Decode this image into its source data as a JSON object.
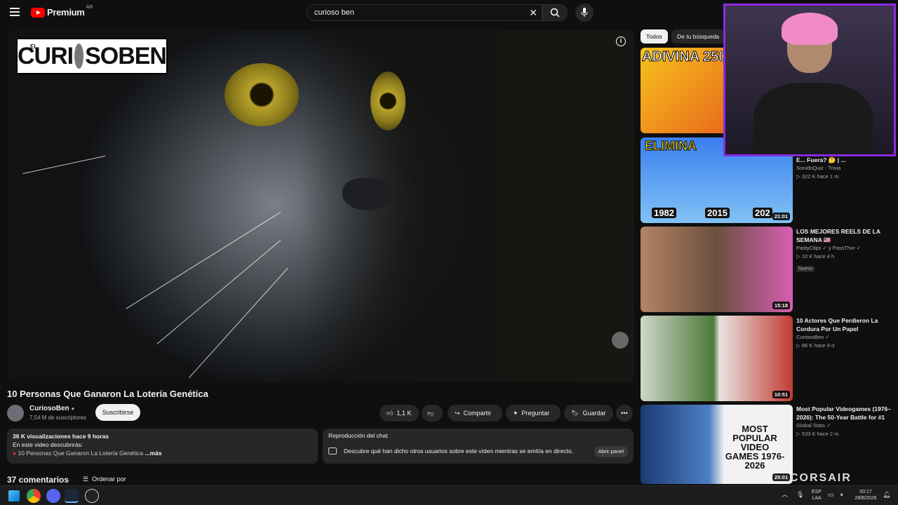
{
  "header": {
    "logo_text": "Premium",
    "logo_region": "AR",
    "search_value": "curioso ben",
    "icons": {
      "menu": "hamburger-icon",
      "clear": "close-icon",
      "search": "search-icon",
      "mic": "microphone-icon"
    }
  },
  "player": {
    "brand_prefix": "EL",
    "brand_left": "CURI",
    "brand_right": "SOBEN"
  },
  "video": {
    "title": "10 Personas Que Ganaron La Lotería Genética",
    "channel": "CuriosoBen",
    "subscribers": "7,54 M de suscriptores",
    "subscribe_label": "Suscribirse",
    "likes": "1,1 K",
    "share_label": "Compartir",
    "ask_label": "Preguntar",
    "save_label": "Guardar"
  },
  "description": {
    "stats": "36 K visualizaciones  hace 9 horas",
    "line1": "En este video descubrirás:",
    "line2": "10 Personas Que Ganaron La Lotería Genética",
    "more": "...más"
  },
  "chat": {
    "title": "Reproducción del chat",
    "text": "Descubre qué han dicho otros usuarios sobre este vídeo mientras se emitía en directo.",
    "button": "Abrir panel"
  },
  "comments": {
    "count_label": "37 comentarios",
    "sort_label": "Ordenar por"
  },
  "sidebar": {
    "chips": [
      "Todos",
      "De tu búsqueda"
    ],
    "videos": [
      {
        "thumb_text": "ADIVINA 250",
        "duration": "",
        "title": "",
        "channel": "",
        "meta": ""
      },
      {
        "thumb_text": "ELIMINA",
        "years": [
          "1982",
          "2015",
          "202"
        ],
        "duration": "21:01",
        "title": "E... Fuera? 🤔 | ...",
        "channel": "SonidoQuiz - Trivia",
        "meta": "▷ 322 K  hace 1 m"
      },
      {
        "duration": "15:18",
        "title": "LOS MEJORES REELS DE LA SEMANA 🇺🇸",
        "channel": "PastyClips ✓ y PassThor ✓",
        "meta": "▷ 10 K  hace 4 h",
        "badge": "Nuevo"
      },
      {
        "duration": "10:51",
        "title": "10 Actores Que Perdieron La Cordura Por Un Papel",
        "channel": "CuriosoBen ✓",
        "meta": "▷ 86 K  hace 9 d"
      },
      {
        "thumb_text": "MOST POPULAR VIDEO GAMES 1976-2026",
        "duration": "25:01",
        "title": "Most Popular Videogames (1976–2026): The 50-Year Battle for #1",
        "channel": "Global Stats ✓",
        "meta": "▷ 533 K  hace 2 m"
      }
    ]
  },
  "overlay": {
    "corsair": "CORSAIR"
  },
  "taskbar": {
    "lang_top": "ESP",
    "lang_bottom": "LAA",
    "time": "00:17",
    "date": "28/8/2026"
  }
}
